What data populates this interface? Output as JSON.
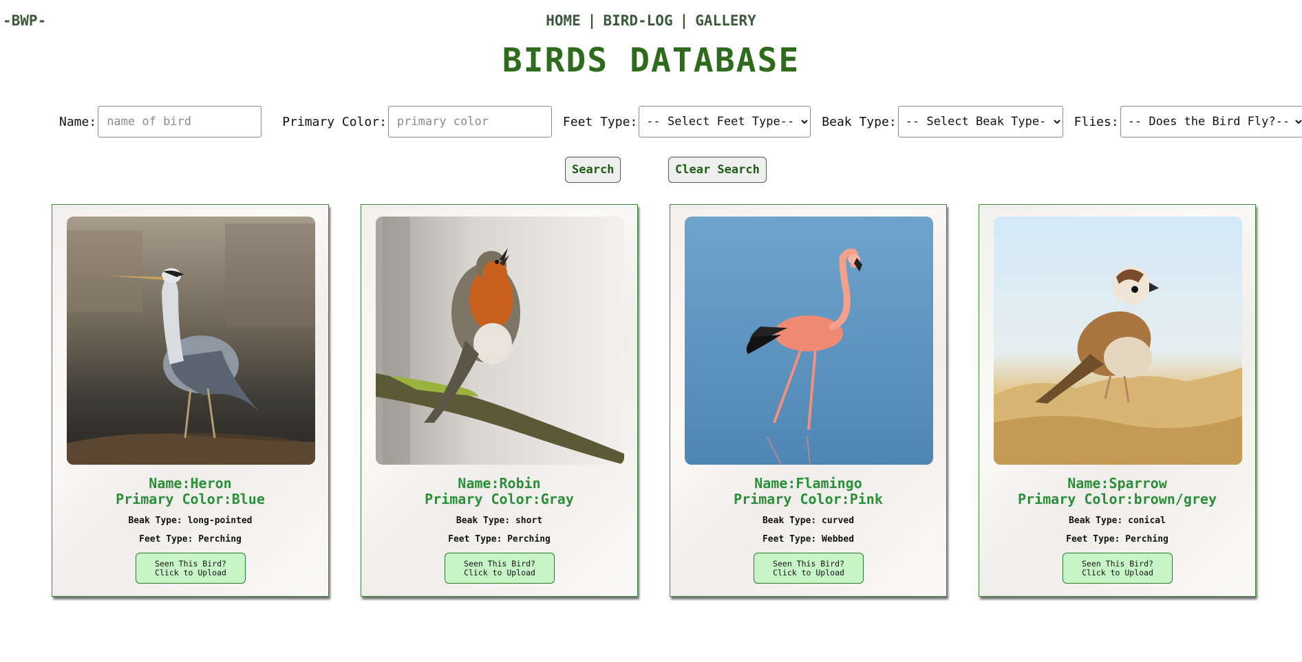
{
  "header": {
    "logo": "-BWP-",
    "nav": [
      {
        "label": "HOME"
      },
      {
        "label": "BIRD-LOG"
      },
      {
        "label": "GALLERY"
      }
    ],
    "separator": "|",
    "title": "BIRDS DATABASE"
  },
  "filters": {
    "name_label": "Name:",
    "name_placeholder": "name of bird",
    "name_value": "",
    "color_label": "Primary Color:",
    "color_placeholder": "primary color",
    "color_value": "",
    "feet_label": "Feet Type:",
    "feet_selected": "-- Select Feet Type--",
    "beak_label": "Beak Type:",
    "beak_selected": "-- Select Beak Type-",
    "flies_label": "Flies:",
    "flies_selected": "-- Does the Bird Fly?--"
  },
  "actions": {
    "search_label": "Search",
    "clear_label": "Clear Search"
  },
  "birds": [
    {
      "name": "Name:Heron",
      "color": "Primary Color:Blue",
      "beak": "Beak Type: long-pointed",
      "feet": "Feet Type: Perching",
      "upload_line1": "Seen This Bird?",
      "upload_line2": "Click to Upload",
      "image": "heron-photo"
    },
    {
      "name": "Name:Robin",
      "color": "Primary Color:Gray",
      "beak": "Beak Type: short",
      "feet": "Feet Type: Perching",
      "upload_line1": "Seen This Bird?",
      "upload_line2": "Click to Upload",
      "image": "robin-photo"
    },
    {
      "name": "Name:Flamingo",
      "color": "Primary Color:Pink",
      "beak": "Beak Type: curved",
      "feet": "Feet Type: Webbed",
      "upload_line1": "Seen This Bird?",
      "upload_line2": "Click to Upload",
      "image": "flamingo-photo"
    },
    {
      "name": "Name:Sparrow",
      "color": "Primary Color:brown/grey",
      "beak": "Beak Type: conical",
      "feet": "Feet Type: Perching",
      "upload_line1": "Seen This Bird?",
      "upload_line2": "Click to Upload",
      "image": "sparrow-photo"
    }
  ],
  "colors": {
    "nav_text": "#3a5a3a",
    "title": "#2e6b1c",
    "card_heading": "#2a8f38",
    "card_border": "#3f8a3f",
    "upload_bg": "#c8f5c8"
  }
}
